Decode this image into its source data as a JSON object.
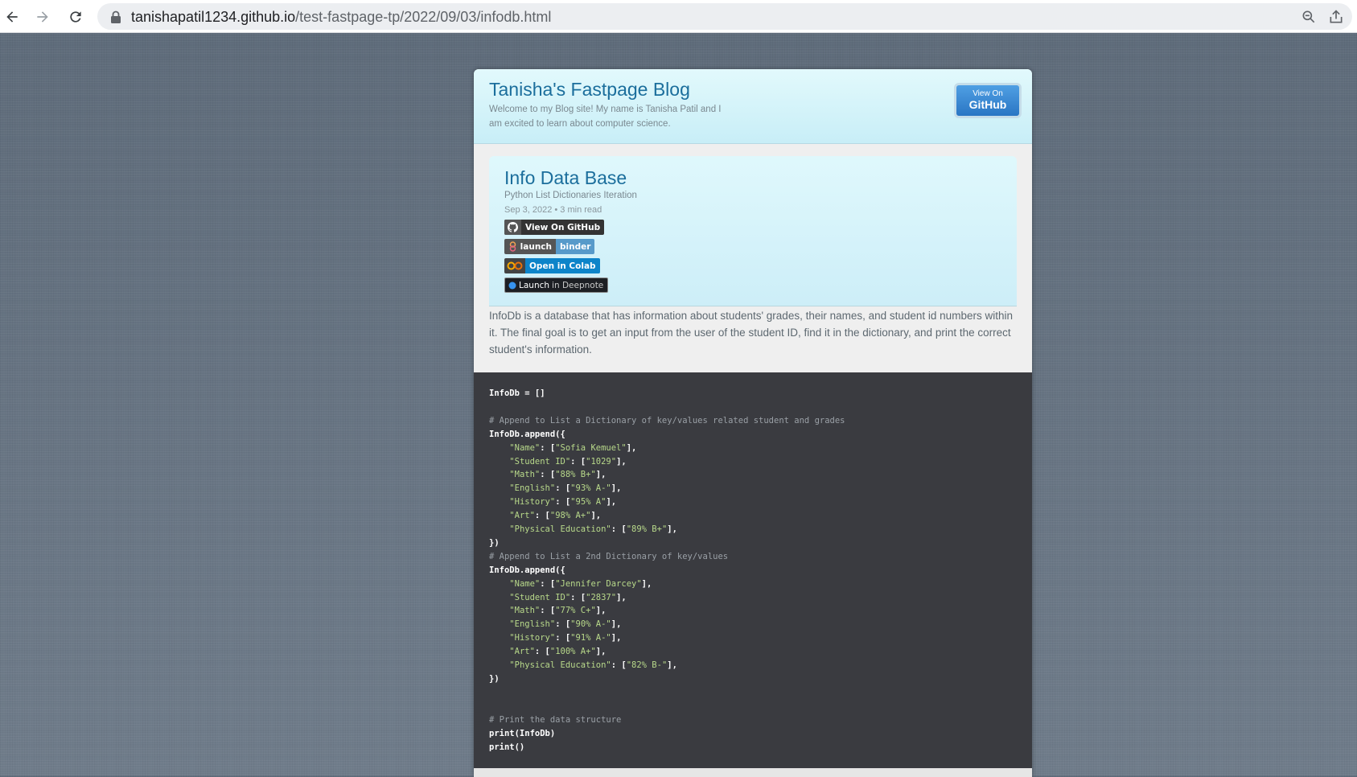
{
  "browser": {
    "url_domain": "tanishapatil1234.github.io",
    "url_path": "/test-fastpage-tp/2022/09/03/infodb.html"
  },
  "site": {
    "title": "Tanisha's Fastpage Blog",
    "description": "Welcome to my Blog site! My name is Tanisha Patil and I am excited to learn about computer science.",
    "github_button_small": "View On",
    "github_button_big": "GitHub"
  },
  "post": {
    "title": "Info Data Base",
    "description": "Python List Dictionaries Iteration",
    "meta": "Sep 3, 2022 • 3 min read",
    "badges": {
      "github": "View On GitHub",
      "binder_left": "launch",
      "binder_right": "binder",
      "colab": "Open in Colab",
      "deepnote_left": "Launch",
      "deepnote_right": "in Deepnote"
    },
    "intro": "InfoDb is a database that has information about students' grades, their names, and student id numbers within it. The final goal is to get an input from the user of the student ID, find it in the dictionary, and print the correct student's information."
  },
  "code": {
    "lines": [
      "InfoDb = []",
      "",
      "# Append to List a Dictionary of key/values related student and grades",
      "InfoDb.append({",
      "    \"Name\": [\"Sofia Kemuel\"],",
      "    \"Student ID\": [\"1029\"],",
      "    \"Math\": [\"88% B+\"],",
      "    \"English\": [\"93% A-\"],",
      "    \"History\": [\"95% A\"],",
      "    \"Art\": [\"98% A+\"],",
      "    \"Physical Education\": [\"89% B+\"],",
      "})",
      "# Append to List a 2nd Dictionary of key/values",
      "InfoDb.append({",
      "    \"Name\": [\"Jennifer Darcey\"],",
      "    \"Student ID\": [\"2837\"],",
      "    \"Math\": [\"77% C+\"],",
      "    \"English\": [\"90% A-\"],",
      "    \"History\": [\"91% A-\"],",
      "    \"Art\": [\"100% A+\"],",
      "    \"Physical Education\": [\"82% B-\"],",
      "})",
      "",
      "",
      "# Print the data structure",
      "print(InfoDb)",
      "print()"
    ]
  },
  "colors": {
    "title_blue": "#1b6e9c",
    "code_bg": "#3a3b40",
    "code_string": "#b8d98a",
    "code_comment": "#9aa0a6"
  }
}
